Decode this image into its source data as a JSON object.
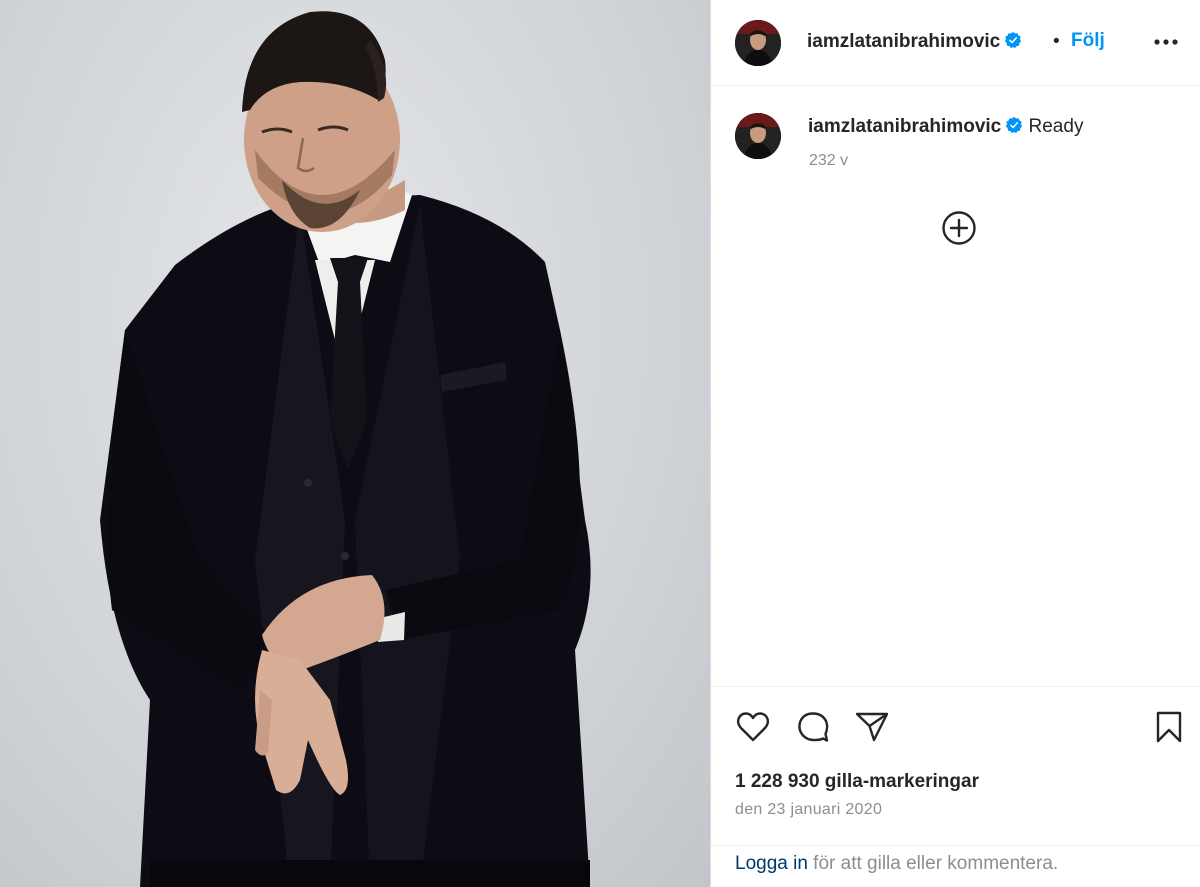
{
  "post": {
    "username": "iamzlatanibrahimovic",
    "separator": "•",
    "follow_label": "Följ",
    "caption": "Ready",
    "caption_age": "232 v",
    "likes": "1 228 930 gilla-markeringar",
    "date": "den 23 januari 2020"
  },
  "login_prompt": {
    "link_label": "Logga in",
    "text": " för att gilla eller kommentera."
  },
  "icons": {
    "verified": "verified-badge-icon",
    "more": "more-options-icon",
    "load_comments": "plus-circle-icon",
    "like": "heart-icon",
    "comment": "comment-bubble-icon",
    "share": "paper-plane-icon",
    "save": "bookmark-icon"
  },
  "colors": {
    "link_blue": "#0095f6",
    "login_link": "#00376b",
    "muted_text": "#8e8e8e",
    "primary_text": "#262626",
    "verified_blue": "#0095f6"
  }
}
